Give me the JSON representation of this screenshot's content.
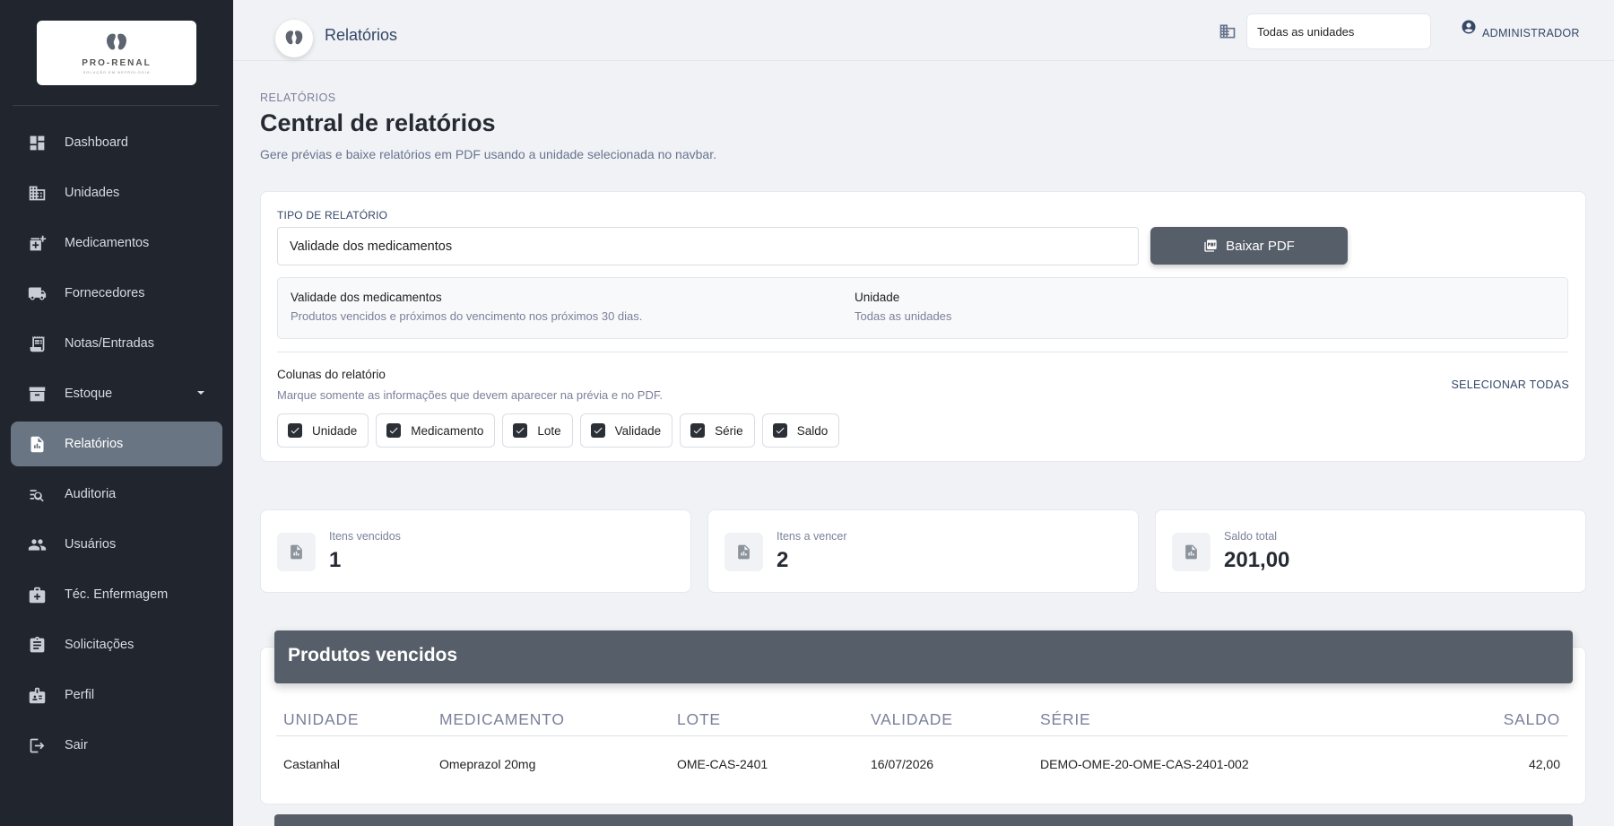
{
  "brand": {
    "logo_text": "PRO-RENAL",
    "logo_sub": "SOLUÇÃO EM NEFROLOGIA"
  },
  "sidebar": {
    "items": [
      {
        "label": "Dashboard",
        "icon": "dashboard-icon"
      },
      {
        "label": "Unidades",
        "icon": "building-icon"
      },
      {
        "label": "Medicamentos",
        "icon": "medical-plus-icon"
      },
      {
        "label": "Fornecedores",
        "icon": "truck-icon"
      },
      {
        "label": "Notas/Entradas",
        "icon": "receipt-icon"
      },
      {
        "label": "Estoque",
        "icon": "archive-icon"
      },
      {
        "label": "Relatórios",
        "icon": "report-icon"
      },
      {
        "label": "Auditoria",
        "icon": "search-list-icon"
      },
      {
        "label": "Usuários",
        "icon": "people-icon"
      },
      {
        "label": "Téc. Enfermagem",
        "icon": "medkit-icon"
      },
      {
        "label": "Solicitações",
        "icon": "clipboard-icon"
      },
      {
        "label": "Perfil",
        "icon": "badge-icon"
      },
      {
        "label": "Sair",
        "icon": "logout-icon"
      }
    ],
    "active": "Relatórios"
  },
  "topbar": {
    "title": "Relatórios",
    "unit_select": "Todas as unidades",
    "user": "ADMINISTRADOR"
  },
  "page": {
    "eyebrow": "RELATÓRIOS",
    "title": "Central de relatórios",
    "subtitle": "Gere prévias e baixe relatórios em PDF usando a unidade selecionada no navbar."
  },
  "config": {
    "type_label": "TIPO DE RELATÓRIO",
    "type_value": "Validade dos medicamentos",
    "download_button": "Baixar PDF",
    "info": {
      "report_title": "Validade dos medicamentos",
      "report_desc": "Produtos vencidos e próximos do vencimento nos próximos 30 dias.",
      "unit_title": "Unidade",
      "unit_value": "Todas as unidades"
    },
    "columns_title": "Colunas do relatório",
    "columns_desc": "Marque somente as informações que devem aparecer na prévia e no PDF.",
    "select_all": "SELECIONAR TODAS",
    "columns": [
      {
        "label": "Unidade",
        "checked": true
      },
      {
        "label": "Medicamento",
        "checked": true
      },
      {
        "label": "Lote",
        "checked": true
      },
      {
        "label": "Validade",
        "checked": true
      },
      {
        "label": "Série",
        "checked": true
      },
      {
        "label": "Saldo",
        "checked": true
      }
    ]
  },
  "stats": [
    {
      "label": "Itens vencidos",
      "value": "1"
    },
    {
      "label": "Itens a vencer",
      "value": "2"
    },
    {
      "label": "Saldo total",
      "value": "201,00"
    }
  ],
  "table": {
    "title": "Produtos vencidos",
    "headers": [
      "UNIDADE",
      "MEDICAMENTO",
      "LOTE",
      "VALIDADE",
      "SÉRIE",
      "SALDO"
    ],
    "rows": [
      [
        "Castanhal",
        "Omeprazol 20mg",
        "OME-CAS-2401",
        "16/07/2026",
        "DEMO-OME-20-OME-CAS-2401-002",
        "42,00"
      ]
    ]
  }
}
